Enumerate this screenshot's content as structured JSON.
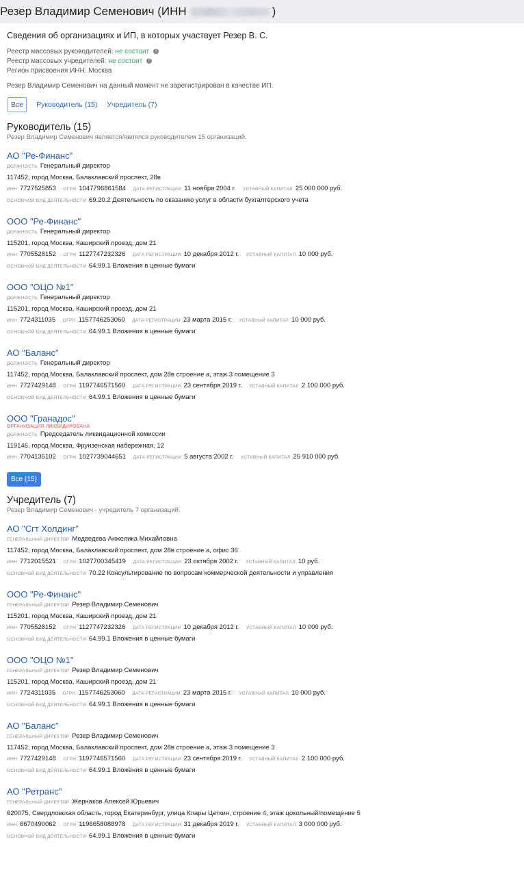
{
  "header": {
    "title_prefix": "Резер Владимир Семенович (ИНН",
    "title_suffix": ")"
  },
  "intro": "Сведения об организациях и ИП, в которых участвует Резер В. С.",
  "registry": {
    "managers_label": "Реестр массовых руководителей:",
    "managers_value": "не состоит",
    "founders_label": "Реестр массовых учредителей:",
    "founders_value": "не состоит",
    "region": "Регион присвоения ИНН: Москва"
  },
  "ip_note": "Резер Владимир Семенович на данный момент не зарегистрирован в качестве ИП.",
  "filters": {
    "all": "Все",
    "manager": "Руководитель (15)",
    "founder": "Учредитель (7)"
  },
  "labels": {
    "position": "ДОЛЖНОСТЬ",
    "gen_dir": "ГЕНЕРАЛЬНЫЙ ДИРЕКТОР",
    "inn": "ИНН",
    "ogrn": "ОГРН",
    "reg_date": "ДАТА РЕГИСТРАЦИИ",
    "capital": "УСТАВНЫЙ КАПИТАЛ",
    "activity": "ОСНОВНОЙ ВИД ДЕЯТЕЛЬНОСТИ",
    "liquidated": "ОРГАНИЗАЦИЯ ЛИКВИДИРОВАНА"
  },
  "manager_section": {
    "title": "Руководитель (15)",
    "subtitle": "Резер Владимир Семенович является/являлся руководителем 15 организаций.",
    "orgs": [
      {
        "name": "АО \"Ре-Финанс\"",
        "person": "Генеральный директор",
        "address": "117452, город Москва, Балаклавский проспект, 28в",
        "inn": "7727525853",
        "ogrn": "1047796861584",
        "date": "11 ноября 2004 г.",
        "capital": "25 000 000 руб.",
        "activity": "69.20.2 Деятельность по оказанию услуг в области бухгалтерского учета"
      },
      {
        "name": "ООО \"Ре-Финанс\"",
        "person": "Генеральный директор",
        "address": "115201, город Москва, Каширский проезд, дом 21",
        "inn": "7705528152",
        "ogrn": "1127747232326",
        "date": "10 декабря 2012 г.",
        "capital": "10 000 руб.",
        "activity": "64.99.1 Вложения в ценные бумаги"
      },
      {
        "name": "ООО \"ОЦО №1\"",
        "person": "Генеральный директор",
        "address": "115201, город Москва, Каширский проезд, дом 21",
        "inn": "7724311035",
        "ogrn": "1157746253060",
        "date": "23 марта 2015 г.",
        "capital": "10 000 руб.",
        "activity": "64.99.1 Вложения в ценные бумаги"
      },
      {
        "name": "АО \"Баланс\"",
        "person": "Генеральный директор",
        "address": "117452, город Москва, Балаклавский проспект, дом 28в строение а, этаж 3 помещение 3",
        "inn": "7727429148",
        "ogrn": "1197746571560",
        "date": "23 сентября 2019 г.",
        "capital": "2 100 000 руб.",
        "activity": "64.99.1 Вложения в ценные бумаги"
      },
      {
        "name": "ООО \"Гранадос\"",
        "liquidated": true,
        "person": "Председатель ликвидационной комиссии",
        "address": "119146, город Москва, Фрунзенская набережная, 12",
        "inn": "7704135102",
        "ogrn": "1027739044651",
        "date": "5 августа 2002 г.",
        "capital": "25 910 000 руб.",
        "activity": ""
      }
    ],
    "all_button": "Все (15)"
  },
  "founder_section": {
    "title": "Учредитель (7)",
    "subtitle": "Резер Владимир Семенович - учредитель 7 организаций.",
    "orgs": [
      {
        "name": "АО \"Сгт Холдинг\"",
        "person": "Медведева Анжелика Михайловна",
        "address": "117452, город Москва, Балаклавский проспект, дом 28в строение а, офис 36",
        "inn": "7712015521",
        "ogrn": "1027700345419",
        "date": "23 октября 2002 г.",
        "capital": "10 руб.",
        "activity": "70.22 Консультирование по вопросам коммерческой деятельности и управления"
      },
      {
        "name": "ООО \"Ре-Финанс\"",
        "person": "Резер Владимир Семенович",
        "address": "115201, город Москва, Каширский проезд, дом 21",
        "inn": "7705528152",
        "ogrn": "1127747232326",
        "date": "10 декабря 2012 г.",
        "capital": "10 000 руб.",
        "activity": "64.99.1 Вложения в ценные бумаги"
      },
      {
        "name": "ООО \"ОЦО №1\"",
        "person": "Резер Владимир Семенович",
        "address": "115201, город Москва, Каширский проезд, дом 21",
        "inn": "7724311035",
        "ogrn": "1157746253060",
        "date": "23 марта 2015 г.",
        "capital": "10 000 руб.",
        "activity": "64.99.1 Вложения в ценные бумаги"
      },
      {
        "name": "АО \"Баланс\"",
        "person": "Резер Владимир Семенович",
        "address": "117452, город Москва, Балаклавский проспект, дом 28в строение а, этаж 3 помещение 3",
        "inn": "7727429148",
        "ogrn": "1197746571560",
        "date": "23 сентября 2019 г.",
        "capital": "2 100 000 руб.",
        "activity": "64.99.1 Вложения в ценные бумаги"
      },
      {
        "name": "АО \"Ретранс\"",
        "person": "Жернаков Алексей Юрьевич",
        "address": "620075, Свердловская область, город Екатеринбург, улица Клары Цеткин, строение 4, этаж цокольный/помещение 5",
        "inn": "6670490062",
        "ogrn": "1196658088978",
        "date": "31 декабря 2019 г.",
        "capital": "3 000 000 руб.",
        "activity": "64.99.1 Вложения в ценные бумаги"
      }
    ]
  }
}
